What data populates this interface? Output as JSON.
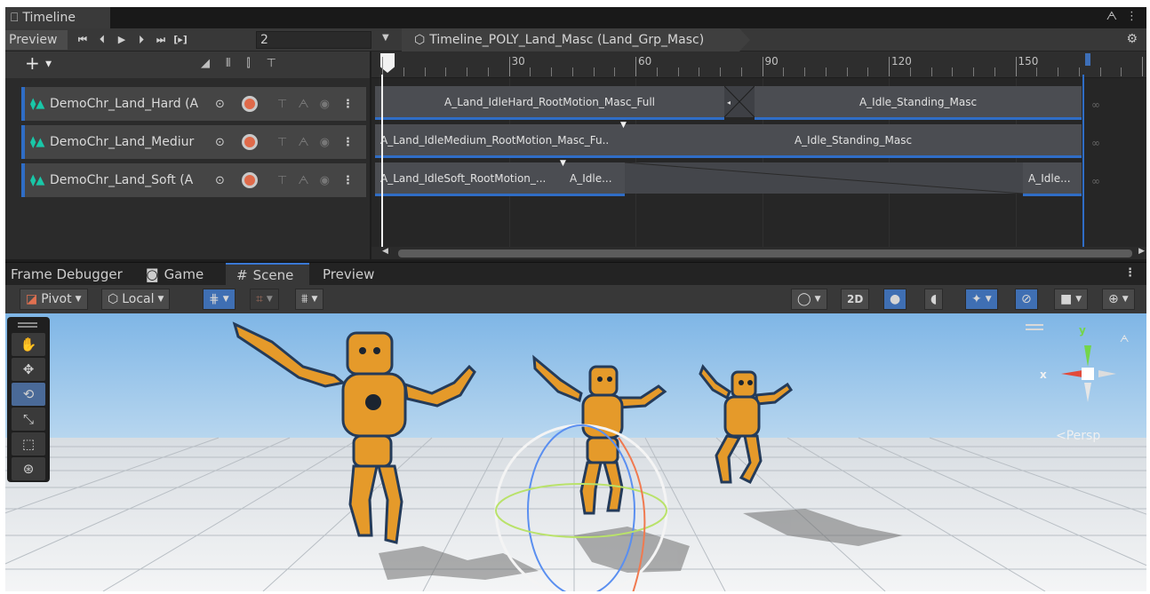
{
  "timeline": {
    "tab_title": "Timeline",
    "preview_label": "Preview",
    "transport": [
      "⏮",
      "⏴",
      "▶",
      "⏵",
      "⏭",
      "[▸]"
    ],
    "frame_value": "2",
    "breadcrumb": "Timeline_POLY_Land_Masc (Land_Grp_Masc)",
    "ruler_labels": [
      "30",
      "60",
      "90",
      "120",
      "150"
    ],
    "tracks": [
      {
        "name": "DemoChr_Land_Hard (A"
      },
      {
        "name": "DemoChr_Land_Mediur"
      },
      {
        "name": "DemoChr_Land_Soft (A"
      }
    ],
    "clips": {
      "hard_1": "A_Land_IdleHard_RootMotion_Masc_Full",
      "hard_2": "A_Idle_Standing_Masc",
      "medium_1": "A_Land_IdleMedium_RootMotion_Masc_Fu..",
      "medium_2": "A_Idle_Standing_Masc",
      "soft_1": "A_Land_IdleSoft_RootMotion_...",
      "soft_2": "A_Idle...",
      "soft_3": "A_Idle..."
    },
    "loop_glyph": "∞"
  },
  "scene": {
    "tabs": [
      "Frame Debugger",
      "Game",
      "Scene",
      "Preview"
    ],
    "pivot_label": "Pivot",
    "local_label": "Local",
    "twod_label": "2D",
    "persp_label": "Persp",
    "axis_x": "x",
    "axis_y": "y"
  },
  "colors": {
    "accent_blue": "#2f6dc6",
    "track_icon": "#19c7a8",
    "record": "#e06a4a",
    "sky": "#7fb6e6",
    "character": "#e59a2a"
  }
}
